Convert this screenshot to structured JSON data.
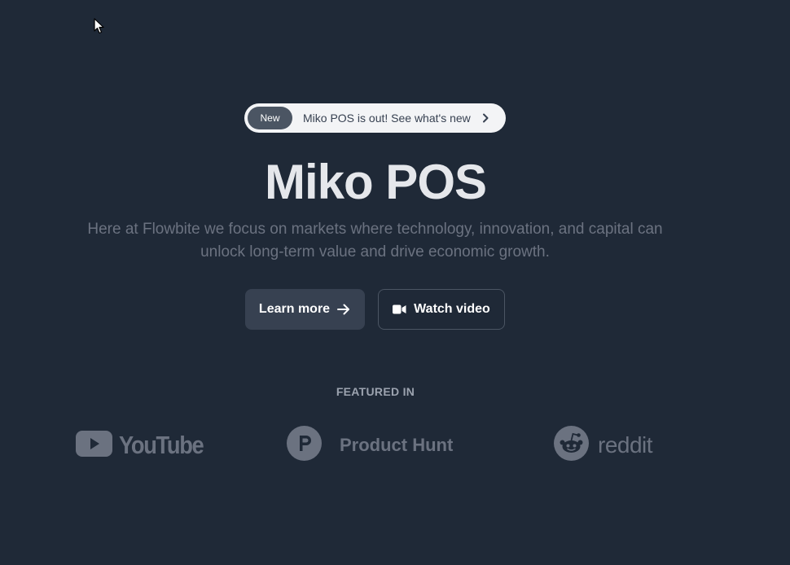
{
  "announcement": {
    "badge": "New",
    "text": "Miko POS is out! See what's new"
  },
  "hero": {
    "title": "Miko POS",
    "description": "Here at Flowbite we focus on markets where technology, innovation, and capital can unlock long-term value and drive economic growth."
  },
  "actions": {
    "learn_more": "Learn more",
    "watch_video": "Watch video"
  },
  "featured": {
    "label": "FEATURED IN",
    "logos": {
      "youtube": "YouTube",
      "producthunt": "Product Hunt",
      "reddit": "reddit"
    }
  },
  "icons": {
    "cursor": "mouse-pointer-icon",
    "announce": "chevron-right-icon",
    "learn_more": "arrow-right-icon",
    "watch_video": "video-camera-icon",
    "youtube": "youtube-play-icon",
    "producthunt": "producthunt-p-icon",
    "reddit": "reddit-alien-icon"
  },
  "colors": {
    "background": "#1f2937",
    "title": "#e5e7eb",
    "muted": "#6b7280",
    "primary_button": "#374151",
    "badge": "#4b5563"
  }
}
